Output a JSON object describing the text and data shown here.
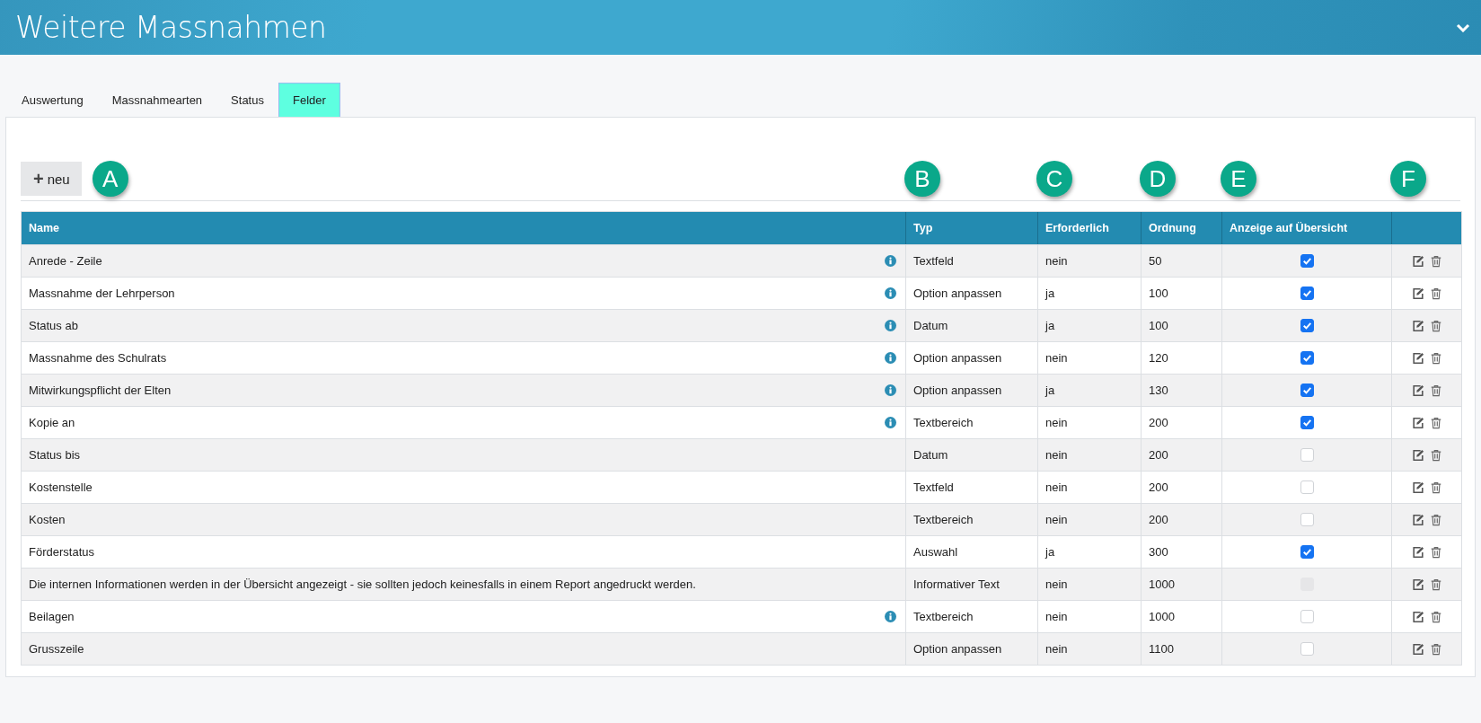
{
  "header": {
    "title": "Weitere Massnahmen"
  },
  "tabs": [
    {
      "label": "Auswertung",
      "selected": false
    },
    {
      "label": "Massnahmearten",
      "selected": false
    },
    {
      "label": "Status",
      "selected": false
    },
    {
      "label": "Felder",
      "selected": true
    }
  ],
  "new_button": {
    "icon": "+",
    "label": "neu"
  },
  "markers": [
    "A",
    "B",
    "C",
    "D",
    "E",
    "F"
  ],
  "table": {
    "columns": [
      "Name",
      "Typ",
      "Erforderlich",
      "Ordnung",
      "Anzeige auf Übersicht"
    ],
    "rows": [
      {
        "name": "Anrede - Zeile",
        "info": true,
        "type": "Textfeld",
        "required": "nein",
        "order": "50",
        "overview": {
          "checked": true,
          "disabled": false
        }
      },
      {
        "name": "Massnahme der Lehrperson",
        "info": true,
        "type": "Option anpassen",
        "required": "ja",
        "order": "100",
        "overview": {
          "checked": true,
          "disabled": false
        }
      },
      {
        "name": "Status ab",
        "info": true,
        "type": "Datum",
        "required": "ja",
        "order": "100",
        "overview": {
          "checked": true,
          "disabled": false
        }
      },
      {
        "name": "Massnahme des Schulrats",
        "info": true,
        "type": "Option anpassen",
        "required": "nein",
        "order": "120",
        "overview": {
          "checked": true,
          "disabled": false
        }
      },
      {
        "name": "Mitwirkungspflicht der Elten",
        "info": true,
        "type": "Option anpassen",
        "required": "ja",
        "order": "130",
        "overview": {
          "checked": true,
          "disabled": false
        }
      },
      {
        "name": "Kopie an",
        "info": true,
        "type": "Textbereich",
        "required": "nein",
        "order": "200",
        "overview": {
          "checked": true,
          "disabled": false
        }
      },
      {
        "name": "Status bis",
        "info": false,
        "type": "Datum",
        "required": "nein",
        "order": "200",
        "overview": {
          "checked": false,
          "disabled": false
        }
      },
      {
        "name": "Kostenstelle",
        "info": false,
        "type": "Textfeld",
        "required": "nein",
        "order": "200",
        "overview": {
          "checked": false,
          "disabled": false
        }
      },
      {
        "name": "Kosten",
        "info": false,
        "type": "Textbereich",
        "required": "nein",
        "order": "200",
        "overview": {
          "checked": false,
          "disabled": false
        }
      },
      {
        "name": "Förderstatus",
        "info": false,
        "type": "Auswahl",
        "required": "ja",
        "order": "300",
        "overview": {
          "checked": true,
          "disabled": false
        }
      },
      {
        "name": "Die internen Informationen werden in der Übersicht angezeigt - sie sollten jedoch keinesfalls in einem Report angedruckt werden.",
        "info": false,
        "type": "Informativer Text",
        "required": "nein",
        "order": "1000",
        "overview": {
          "checked": false,
          "disabled": true
        }
      },
      {
        "name": "Beilagen",
        "info": true,
        "type": "Textbereich",
        "required": "nein",
        "order": "1000",
        "overview": {
          "checked": false,
          "disabled": false
        }
      },
      {
        "name": "Grusszeile",
        "info": false,
        "type": "Option anpassen",
        "required": "nein",
        "order": "1100",
        "overview": {
          "checked": false,
          "disabled": false
        }
      }
    ]
  }
}
